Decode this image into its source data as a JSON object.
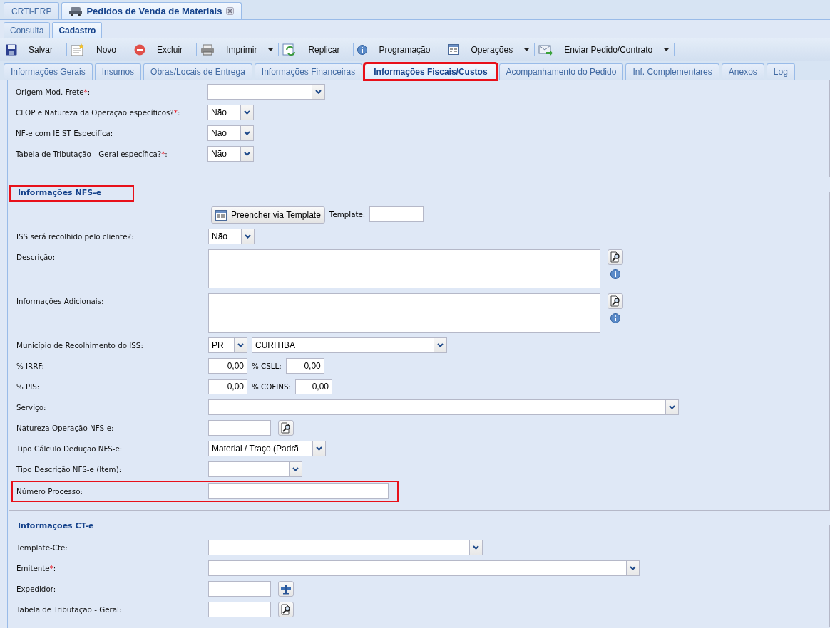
{
  "window_tabs": [
    {
      "label": "CRTI-ERP",
      "selected": false,
      "closable": false
    },
    {
      "label": "Pedidos de Venda de Materiais",
      "selected": true,
      "closable": true
    }
  ],
  "view_tabs": [
    {
      "label": "Consulta",
      "selected": false
    },
    {
      "label": "Cadastro",
      "selected": true
    }
  ],
  "toolbar": [
    {
      "label": "Salvar",
      "dropdown": false
    },
    {
      "label": "Novo",
      "dropdown": false
    },
    {
      "label": "Excluir",
      "dropdown": false
    },
    {
      "label": "Imprimir",
      "dropdown": true
    },
    {
      "label": "Replicar",
      "dropdown": false
    },
    {
      "label": "Programação",
      "dropdown": false
    },
    {
      "label": "Operações",
      "dropdown": true
    },
    {
      "label": "Enviar Pedido/Contrato",
      "dropdown": true
    }
  ],
  "form_tabs": [
    {
      "label": "Informações Gerais",
      "selected": false,
      "highlighted": false
    },
    {
      "label": "Insumos",
      "selected": false,
      "highlighted": false
    },
    {
      "label": "Obras/Locais de Entrega",
      "selected": false,
      "highlighted": false
    },
    {
      "label": "Informações Financeiras",
      "selected": false,
      "highlighted": false
    },
    {
      "label": "Informações Fiscais/Custos",
      "selected": true,
      "highlighted": true
    },
    {
      "label": "Acompanhamento do Pedido",
      "selected": false,
      "highlighted": false
    },
    {
      "label": "Inf. Complementares",
      "selected": false,
      "highlighted": false
    },
    {
      "label": "Anexos",
      "selected": false,
      "highlighted": false
    },
    {
      "label": "Log",
      "selected": false,
      "highlighted": false
    }
  ],
  "sections": [
    {
      "rows": [
        {
          "label": "Origem Mod. Frete",
          "required_mark": "*",
          "label_end": ":",
          "highlighted": false,
          "controls": [
            {
              "kind": "select"
            }
          ]
        },
        {
          "label": "CFOP e Natureza da Operação específicos?",
          "required_mark": "*",
          "label_end": ":",
          "highlighted": false,
          "controls": [
            {
              "kind": "select",
              "value": "Não"
            }
          ]
        },
        {
          "label": "NF-e com IE ST Especifíca:",
          "highlighted": false,
          "controls": [
            {
              "kind": "select",
              "value": "Não"
            }
          ]
        },
        {
          "label": "Tabela de Tributação - Geral específica?",
          "required_mark": "*",
          "label_end": ":",
          "highlighted": false,
          "controls": [
            {
              "kind": "select",
              "value": "Não"
            }
          ]
        }
      ]
    },
    {
      "legend": "Informações NFS-e",
      "highlighted": true,
      "rows": [
        {
          "highlighted": false,
          "controls": [
            {
              "kind": "button",
              "label": "Preencher via Template"
            },
            {
              "kind": "text",
              "text": "Template:"
            },
            {
              "kind": "input"
            }
          ]
        },
        {
          "label": "ISS será recolhido pelo cliente?:",
          "highlighted": false,
          "controls": [
            {
              "kind": "select",
              "value": "Não"
            }
          ]
        },
        {
          "label": "Descrição:",
          "highlighted": false,
          "controls": [
            {
              "kind": "textarea"
            },
            {
              "kind": "lookup",
              "info": true
            }
          ]
        },
        {
          "label": "Informações Adicionais:",
          "highlighted": false,
          "controls": [
            {
              "kind": "textarea"
            },
            {
              "kind": "lookup",
              "info": true
            }
          ]
        },
        {
          "label": "Município de Recolhimento do ISS:",
          "highlighted": false,
          "controls": [
            {
              "kind": "select",
              "value": "PR"
            },
            {
              "kind": "select",
              "value": "CURITIBA"
            }
          ]
        },
        {
          "label": "% IRRF:",
          "highlighted": false,
          "controls": [
            {
              "kind": "number",
              "value": "0,00"
            },
            {
              "kind": "text",
              "text": "% CSLL:"
            },
            {
              "kind": "number",
              "value": "0,00"
            }
          ]
        },
        {
          "label": "% PIS:",
          "highlighted": false,
          "controls": [
            {
              "kind": "number",
              "value": "0,00"
            },
            {
              "kind": "text",
              "text": "% COFINS:"
            },
            {
              "kind": "number",
              "value": "0,00"
            }
          ]
        },
        {
          "label": "Serviço:",
          "highlighted": false,
          "controls": [
            {
              "kind": "select"
            }
          ]
        },
        {
          "label": "Natureza Operação NFS-e:",
          "highlighted": false,
          "controls": [
            {
              "kind": "input"
            },
            {
              "kind": "lookup",
              "info": false
            }
          ]
        },
        {
          "label": "Tipo Cálculo Dedução NFS-e:",
          "highlighted": false,
          "controls": [
            {
              "kind": "select",
              "value": "Material / Traço (Padrã"
            }
          ]
        },
        {
          "label": "Tipo Descrição NFS-e (Item):",
          "highlighted": false,
          "controls": [
            {
              "kind": "select"
            }
          ]
        },
        {
          "label": "Número Processo:",
          "highlighted": true,
          "controls": [
            {
              "kind": "input"
            }
          ]
        }
      ]
    },
    {
      "legend": "Informações CT-e",
      "highlighted": false,
      "rows": [
        {
          "label": "Template-Cte:",
          "highlighted": false,
          "controls": [
            {
              "kind": "select"
            }
          ]
        },
        {
          "label": "Emitente",
          "required_mark": "*",
          "label_end": ":",
          "highlighted": false,
          "controls": [
            {
              "kind": "select"
            }
          ]
        },
        {
          "label": "Expedidor:",
          "highlighted": false,
          "controls": [
            {
              "kind": "input"
            },
            {
              "kind": "pick"
            }
          ]
        },
        {
          "label": "Tabela de Tributação - Geral:",
          "highlighted": false,
          "controls": [
            {
              "kind": "input"
            },
            {
              "kind": "lookup",
              "info": false
            }
          ]
        }
      ]
    }
  ]
}
